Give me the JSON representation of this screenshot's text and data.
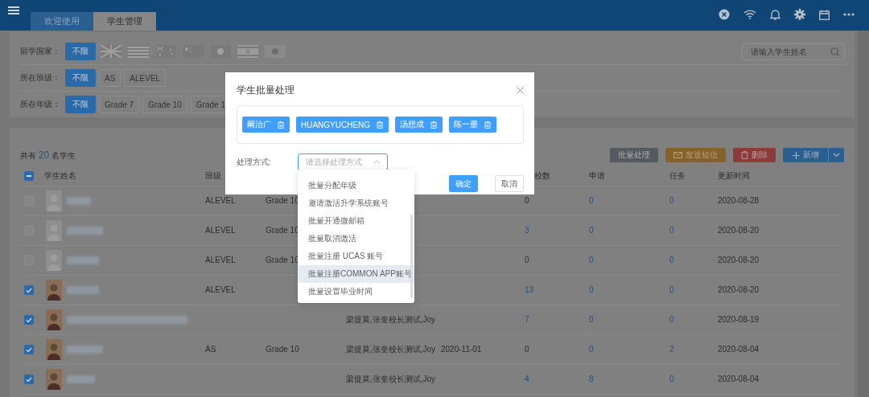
{
  "top_bar": {
    "tabs": [
      {
        "label": "欢迎使用",
        "selected": false
      },
      {
        "label": "学生管理",
        "selected": true
      }
    ]
  },
  "filters": [
    {
      "label": "留学国家：",
      "options": [
        {
          "kind": "text",
          "label": "不限",
          "selected": true
        },
        {
          "kind": "flag",
          "selected": false
        },
        {
          "kind": "flag",
          "selected": false
        },
        {
          "kind": "flag",
          "selected": false
        },
        {
          "kind": "flag",
          "selected": false
        },
        {
          "kind": "flag",
          "selected": false
        },
        {
          "kind": "flag",
          "selected": false
        },
        {
          "kind": "flag",
          "selected": false
        }
      ]
    },
    {
      "label": "所在班级：",
      "options": [
        {
          "kind": "text",
          "label": "不限",
          "selected": true
        },
        {
          "kind": "text",
          "label": "AS",
          "selected": false
        },
        {
          "kind": "text",
          "label": "ALEVEL",
          "selected": false
        }
      ]
    },
    {
      "label": "所在年级：",
      "options": [
        {
          "kind": "text",
          "label": "不限",
          "selected": true
        },
        {
          "kind": "text",
          "label": "Grade 7",
          "selected": false
        },
        {
          "kind": "text",
          "label": "Grade 10",
          "selected": false
        },
        {
          "kind": "text",
          "label": "Grade 1",
          "selected": false
        }
      ]
    }
  ],
  "search": {
    "placeholder": "请输入学生姓名"
  },
  "student_list": {
    "count_prefix": "共有",
    "count": "20",
    "count_suffix": "名学生",
    "actions": [
      {
        "kind": "neutral",
        "label": "批量处理"
      },
      {
        "kind": "warning",
        "label": "发送短信"
      },
      {
        "kind": "danger",
        "label": "删除"
      },
      {
        "kind": "primary",
        "label": "新增"
      }
    ],
    "select_all": {
      "indeterminate": true
    },
    "columns": {
      "name": "学生姓名",
      "class": "班级",
      "schools": "校数",
      "applications": "申请",
      "tasks": "任务",
      "updated": "更新时间"
    },
    "rows": [
      {
        "checked": false,
        "avatar": {
          "kind": "default"
        },
        "class": "ALEVEL",
        "grade": "Grade 10",
        "schools": {
          "text": "0",
          "link": false
        },
        "applications": "0",
        "tasks": "0",
        "updated": "2020-08-28"
      },
      {
        "checked": false,
        "avatar": {
          "kind": "default"
        },
        "class": "ALEVEL",
        "grade": "Grade 10",
        "schools": {
          "text": "3",
          "link": true
        },
        "applications": "0",
        "tasks": "0",
        "updated": "2020-08-20"
      },
      {
        "checked": false,
        "avatar": {
          "kind": "default"
        },
        "class": "ALEVEL",
        "grade": "Grade 10",
        "schools": {
          "text": "0",
          "link": false
        },
        "applications": "0",
        "tasks": "0",
        "updated": "2020-08-20"
      },
      {
        "checked": true,
        "avatar": {
          "kind": "illustrated"
        },
        "class": "ALEVEL",
        "schools": {
          "text": "13",
          "link": true
        },
        "applications": "0",
        "tasks": "0",
        "updated": "2020-08-20"
      },
      {
        "checked": true,
        "avatar": {
          "kind": "illustrated"
        },
        "teachers": "梁提莫,张奎校长测试,Joy",
        "schools": {
          "text": "7",
          "link": true
        },
        "applications": "0",
        "tasks": "0",
        "updated": "2020-08-19"
      },
      {
        "checked": true,
        "avatar": {
          "kind": "illustrated"
        },
        "class": "AS",
        "grade": "Grade 10",
        "teachers": "梁提莫,张奎校长测试,Joy",
        "date": "2020-11-01",
        "schools": {
          "text": "0",
          "link": false
        },
        "applications": "0",
        "tasks": "2",
        "updated": "2020-08-04"
      },
      {
        "checked": true,
        "avatar": {
          "kind": "illustrated"
        },
        "teachers": "梁提莫,张奎校长测试,Joy",
        "schools": {
          "text": "4",
          "link": true
        },
        "applications": "8",
        "tasks": "0",
        "updated": "2020-08-04"
      }
    ]
  },
  "dialog": {
    "title": "学生批量处理",
    "students": [
      {
        "name": "阚治广"
      },
      {
        "name": "HUANGYUCHENG"
      },
      {
        "name": "汤想成"
      },
      {
        "name": "陈一册"
      }
    ],
    "method_label": "处理方式:",
    "method_placeholder": "请选择处理方式",
    "confirm": "确定",
    "cancel": "取消",
    "options": [
      {
        "label": "批量分配年级",
        "highlighted": false
      },
      {
        "label": "邀请激活升学系统账号",
        "highlighted": false
      },
      {
        "label": "批量开通微邮箱",
        "highlighted": false
      },
      {
        "label": "批量取消激活",
        "highlighted": false
      },
      {
        "label": "批量注册 UCAS 账号",
        "highlighted": false
      },
      {
        "label": "批量注册COMMON APP账号",
        "highlighted": true
      },
      {
        "label": "批量设置毕业时间",
        "highlighted": false
      }
    ]
  }
}
